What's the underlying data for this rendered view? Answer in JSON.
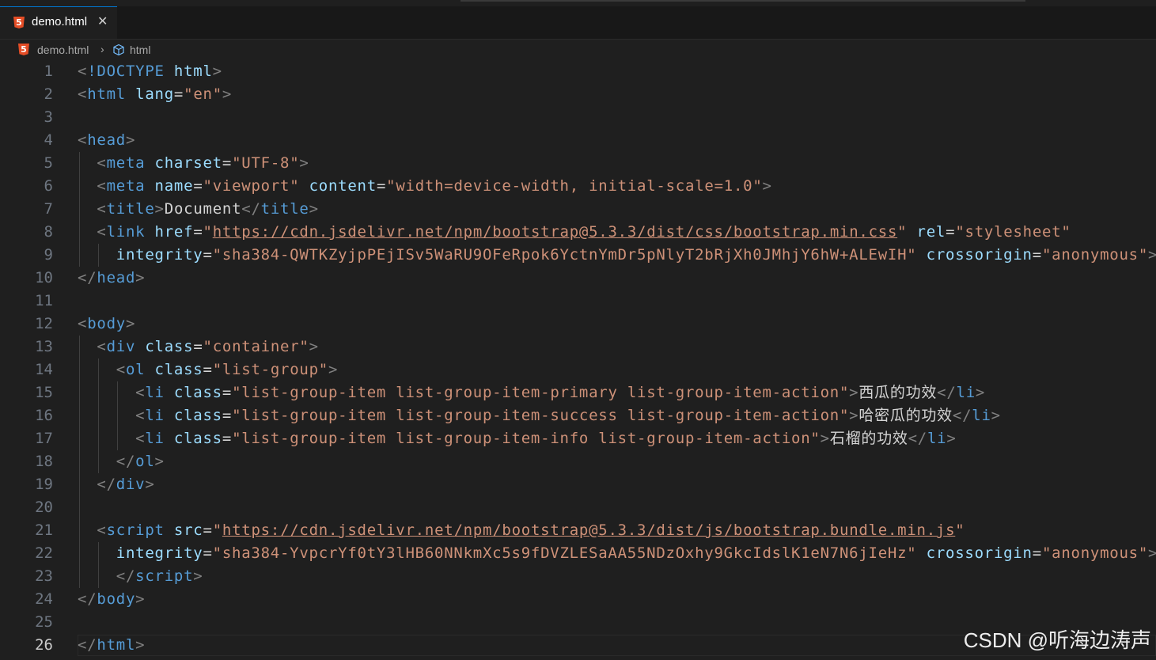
{
  "tab": {
    "filename": "demo.html",
    "close": "✕",
    "icon": "html5-icon",
    "icon_glyph": "5"
  },
  "breadcrumb": {
    "file": "demo.html",
    "separator": "›",
    "element": "html",
    "element_icon": "cube-icon"
  },
  "editor": {
    "active_line": 26,
    "lines": [
      {
        "n": "1",
        "t": [
          [
            "tg",
            "<"
          ],
          [
            "tn",
            "!DOCTYPE "
          ],
          [
            "at",
            "html"
          ],
          [
            "tg",
            ">"
          ]
        ]
      },
      {
        "n": "2",
        "t": [
          [
            "tg",
            "<"
          ],
          [
            "tn",
            "html "
          ],
          [
            "at",
            "lang"
          ],
          [
            "tx",
            "="
          ],
          [
            "sv",
            "\"en\""
          ],
          [
            "tg",
            ">"
          ]
        ]
      },
      {
        "n": "3",
        "t": []
      },
      {
        "n": "4",
        "t": [
          [
            "tg",
            "<"
          ],
          [
            "tn",
            "head"
          ],
          [
            "tg",
            ">"
          ]
        ]
      },
      {
        "n": "5",
        "t": [
          [
            "tx",
            "  "
          ],
          [
            "tg",
            "<"
          ],
          [
            "tn",
            "meta "
          ],
          [
            "at",
            "charset"
          ],
          [
            "tx",
            "="
          ],
          [
            "sv",
            "\"UTF-8\""
          ],
          [
            "tg",
            ">"
          ]
        ]
      },
      {
        "n": "6",
        "t": [
          [
            "tx",
            "  "
          ],
          [
            "tg",
            "<"
          ],
          [
            "tn",
            "meta "
          ],
          [
            "at",
            "name"
          ],
          [
            "tx",
            "="
          ],
          [
            "sv",
            "\"viewport\" "
          ],
          [
            "at",
            "content"
          ],
          [
            "tx",
            "="
          ],
          [
            "sv",
            "\"width=device-width, initial-scale=1.0\""
          ],
          [
            "tg",
            ">"
          ]
        ]
      },
      {
        "n": "7",
        "t": [
          [
            "tx",
            "  "
          ],
          [
            "tg",
            "<"
          ],
          [
            "tn",
            "title"
          ],
          [
            "tg",
            ">"
          ],
          [
            "tx",
            "Document"
          ],
          [
            "tg",
            "</"
          ],
          [
            "tn",
            "title"
          ],
          [
            "tg",
            ">"
          ]
        ]
      },
      {
        "n": "8",
        "t": [
          [
            "tx",
            "  "
          ],
          [
            "tg",
            "<"
          ],
          [
            "tn",
            "link "
          ],
          [
            "at",
            "href"
          ],
          [
            "tx",
            "="
          ],
          [
            "sv",
            "\""
          ],
          [
            "svu",
            "https://cdn.jsdelivr.net/npm/bootstrap@5.3.3/dist/css/bootstrap.min.css"
          ],
          [
            "sv",
            "\" "
          ],
          [
            "at",
            "rel"
          ],
          [
            "tx",
            "="
          ],
          [
            "sv",
            "\"stylesheet\""
          ]
        ]
      },
      {
        "n": "9",
        "t": [
          [
            "tx",
            "    "
          ],
          [
            "at",
            "integrity"
          ],
          [
            "tx",
            "="
          ],
          [
            "sv",
            "\"sha384-QWTKZyjpPEjISv5WaRU9OFeRpok6YctnYmDr5pNlyT2bRjXh0JMhjY6hW+ALEwIH\" "
          ],
          [
            "at",
            "crossorigin"
          ],
          [
            "tx",
            "="
          ],
          [
            "sv",
            "\"anonymous\""
          ],
          [
            "tg",
            ">"
          ]
        ]
      },
      {
        "n": "10",
        "t": [
          [
            "tg",
            "</"
          ],
          [
            "tn",
            "head"
          ],
          [
            "tg",
            ">"
          ]
        ]
      },
      {
        "n": "11",
        "t": []
      },
      {
        "n": "12",
        "t": [
          [
            "tg",
            "<"
          ],
          [
            "tn",
            "body"
          ],
          [
            "tg",
            ">"
          ]
        ]
      },
      {
        "n": "13",
        "t": [
          [
            "tx",
            "  "
          ],
          [
            "tg",
            "<"
          ],
          [
            "tn",
            "div "
          ],
          [
            "at",
            "class"
          ],
          [
            "tx",
            "="
          ],
          [
            "sv",
            "\"container\""
          ],
          [
            "tg",
            ">"
          ]
        ]
      },
      {
        "n": "14",
        "t": [
          [
            "tx",
            "    "
          ],
          [
            "tg",
            "<"
          ],
          [
            "tn",
            "ol "
          ],
          [
            "at",
            "class"
          ],
          [
            "tx",
            "="
          ],
          [
            "sv",
            "\"list-group\""
          ],
          [
            "tg",
            ">"
          ]
        ]
      },
      {
        "n": "15",
        "t": [
          [
            "tx",
            "      "
          ],
          [
            "tg",
            "<"
          ],
          [
            "tn",
            "li "
          ],
          [
            "at",
            "class"
          ],
          [
            "tx",
            "="
          ],
          [
            "sv",
            "\"list-group-item list-group-item-primary list-group-item-action\""
          ],
          [
            "tg",
            ">"
          ],
          [
            "tx",
            "西瓜的功效"
          ],
          [
            "tg",
            "</"
          ],
          [
            "tn",
            "li"
          ],
          [
            "tg",
            ">"
          ]
        ]
      },
      {
        "n": "16",
        "t": [
          [
            "tx",
            "      "
          ],
          [
            "tg",
            "<"
          ],
          [
            "tn",
            "li "
          ],
          [
            "at",
            "class"
          ],
          [
            "tx",
            "="
          ],
          [
            "sv",
            "\"list-group-item list-group-item-success list-group-item-action\""
          ],
          [
            "tg",
            ">"
          ],
          [
            "tx",
            "哈密瓜的功效"
          ],
          [
            "tg",
            "</"
          ],
          [
            "tn",
            "li"
          ],
          [
            "tg",
            ">"
          ]
        ]
      },
      {
        "n": "17",
        "t": [
          [
            "tx",
            "      "
          ],
          [
            "tg",
            "<"
          ],
          [
            "tn",
            "li "
          ],
          [
            "at",
            "class"
          ],
          [
            "tx",
            "="
          ],
          [
            "sv",
            "\"list-group-item list-group-item-info list-group-item-action\""
          ],
          [
            "tg",
            ">"
          ],
          [
            "tx",
            "石榴的功效"
          ],
          [
            "tg",
            "</"
          ],
          [
            "tn",
            "li"
          ],
          [
            "tg",
            ">"
          ]
        ]
      },
      {
        "n": "18",
        "t": [
          [
            "tx",
            "    "
          ],
          [
            "tg",
            "</"
          ],
          [
            "tn",
            "ol"
          ],
          [
            "tg",
            ">"
          ]
        ]
      },
      {
        "n": "19",
        "t": [
          [
            "tx",
            "  "
          ],
          [
            "tg",
            "</"
          ],
          [
            "tn",
            "div"
          ],
          [
            "tg",
            ">"
          ]
        ]
      },
      {
        "n": "20",
        "t": []
      },
      {
        "n": "21",
        "t": [
          [
            "tx",
            "  "
          ],
          [
            "tg",
            "<"
          ],
          [
            "tn",
            "script "
          ],
          [
            "at",
            "src"
          ],
          [
            "tx",
            "="
          ],
          [
            "sv",
            "\""
          ],
          [
            "svu",
            "https://cdn.jsdelivr.net/npm/bootstrap@5.3.3/dist/js/bootstrap.bundle.min.js"
          ],
          [
            "sv",
            "\""
          ]
        ]
      },
      {
        "n": "22",
        "t": [
          [
            "tx",
            "    "
          ],
          [
            "at",
            "integrity"
          ],
          [
            "tx",
            "="
          ],
          [
            "sv",
            "\"sha384-YvpcrYf0tY3lHB60NNkmXc5s9fDVZLESaAA55NDzOxhy9GkcIdslK1eN7N6jIeHz\" "
          ],
          [
            "at",
            "crossorigin"
          ],
          [
            "tx",
            "="
          ],
          [
            "sv",
            "\"anonymous\""
          ],
          [
            "tg",
            ">"
          ]
        ]
      },
      {
        "n": "23",
        "t": [
          [
            "tx",
            "    "
          ],
          [
            "tg",
            "</"
          ],
          [
            "tn",
            "script"
          ],
          [
            "tg",
            ">"
          ]
        ]
      },
      {
        "n": "24",
        "t": [
          [
            "tg",
            "</"
          ],
          [
            "tn",
            "body"
          ],
          [
            "tg",
            ">"
          ]
        ]
      },
      {
        "n": "25",
        "t": []
      },
      {
        "n": "26",
        "t": [
          [
            "tg",
            "</"
          ],
          [
            "tn",
            "html"
          ],
          [
            "tg",
            ">"
          ]
        ]
      }
    ]
  },
  "watermark": "CSDN @听海边涛声"
}
